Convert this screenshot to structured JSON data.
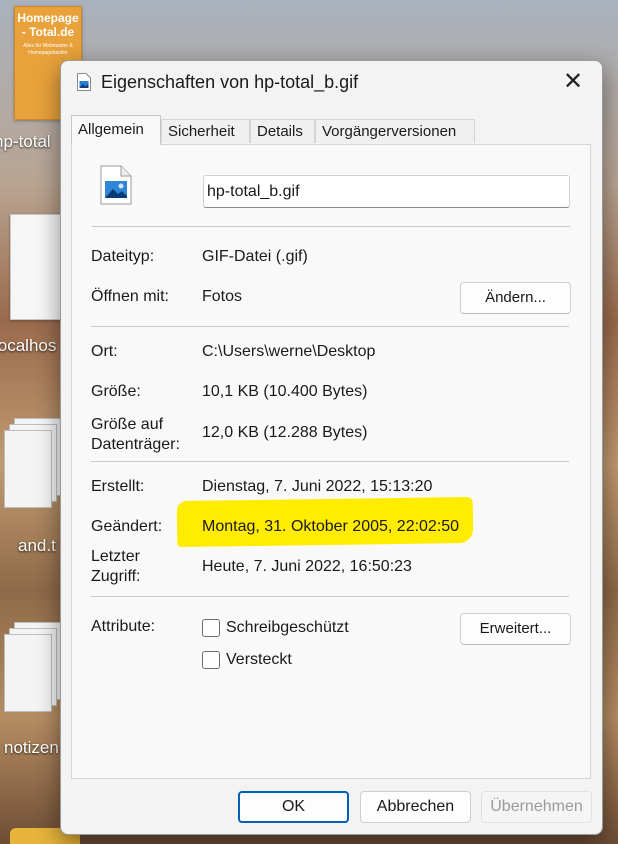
{
  "desktop": {
    "icons": [
      {
        "thumb_title": "Homepage - Total.de",
        "thumb_subtitle": "Alles für Webmaster & Homepagebastler",
        "label": "hp-total"
      },
      {
        "label": "localhos"
      },
      {
        "label": "and.t"
      },
      {
        "label": "notizen"
      }
    ]
  },
  "dialog": {
    "title": "Eigenschaften von hp-total_b.gif",
    "close_symbol": "✕",
    "tabs": [
      {
        "label": "Allgemein",
        "active": true
      },
      {
        "label": "Sicherheit",
        "active": false
      },
      {
        "label": "Details",
        "active": false
      },
      {
        "label": "Vorgängerversionen",
        "active": false
      }
    ],
    "file_name": "hp-total_b.gif",
    "rows": {
      "type_label": "Dateityp:",
      "type_value": "GIF-Datei (.gif)",
      "open_label": "Öffnen mit:",
      "open_value": "Fotos",
      "change_button": "Ändern...",
      "location_label": "Ort:",
      "location_value": "C:\\Users\\werne\\Desktop",
      "size_label": "Größe:",
      "size_value": "10,1 KB (10.400 Bytes)",
      "disk_size_label_1": "Größe auf",
      "disk_size_label_2": "Datenträger:",
      "disk_size_value": "12,0 KB (12.288 Bytes)",
      "created_label": "Erstellt:",
      "created_value": "Dienstag, 7. Juni 2022, 15:13:20",
      "modified_label": "Geändert:",
      "modified_value": "Montag, 31. Oktober 2005, 22:02:50",
      "accessed_label_1": "Letzter",
      "accessed_label_2": "Zugriff:",
      "accessed_value": "Heute, 7. Juni 2022, 16:50:23",
      "attributes_label": "Attribute:",
      "readonly_label": "Schreibgeschützt",
      "readonly_checked": false,
      "hidden_label": "Versteckt",
      "hidden_checked": false,
      "advanced_button": "Erweitert..."
    },
    "footer": {
      "ok": "OK",
      "cancel": "Abbrechen",
      "apply": "Übernehmen"
    },
    "colors": {
      "highlight": "#ffec00",
      "accent": "#005fb8"
    }
  }
}
